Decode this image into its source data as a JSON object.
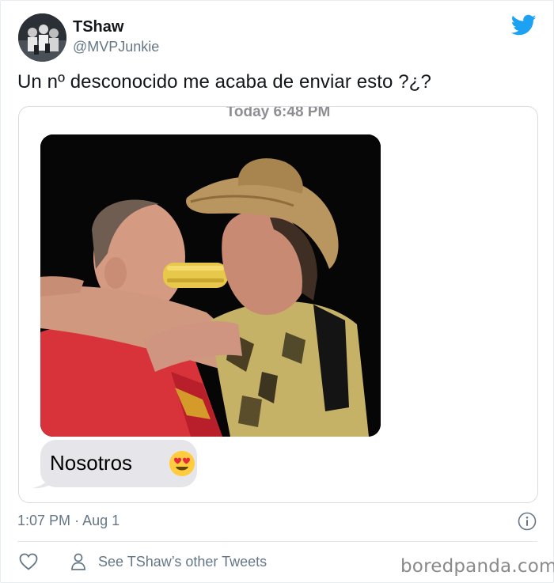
{
  "tweet": {
    "display_name": "TShaw",
    "handle": "@MVPJunkie",
    "text": "Un nº desconocido me acaba de enviar esto ?¿?",
    "time": "1:07 PM",
    "separator": "·",
    "date": "Aug 1"
  },
  "screenshot": {
    "timestamp": "Today 6:48 PM",
    "message": "Nosotros",
    "message_emoji": "heart-eyes-emoji"
  },
  "actions": {
    "like_icon": "heart-icon",
    "profile_icon": "person-icon",
    "other_tweets_label": "See TShaw’s other Tweets",
    "info_icon": "info-icon"
  },
  "watermark": "boredpanda.com",
  "colors": {
    "twitter_blue": "#1da1f2",
    "secondary_text": "#657786",
    "imessage_gray": "#e5e5ea"
  }
}
